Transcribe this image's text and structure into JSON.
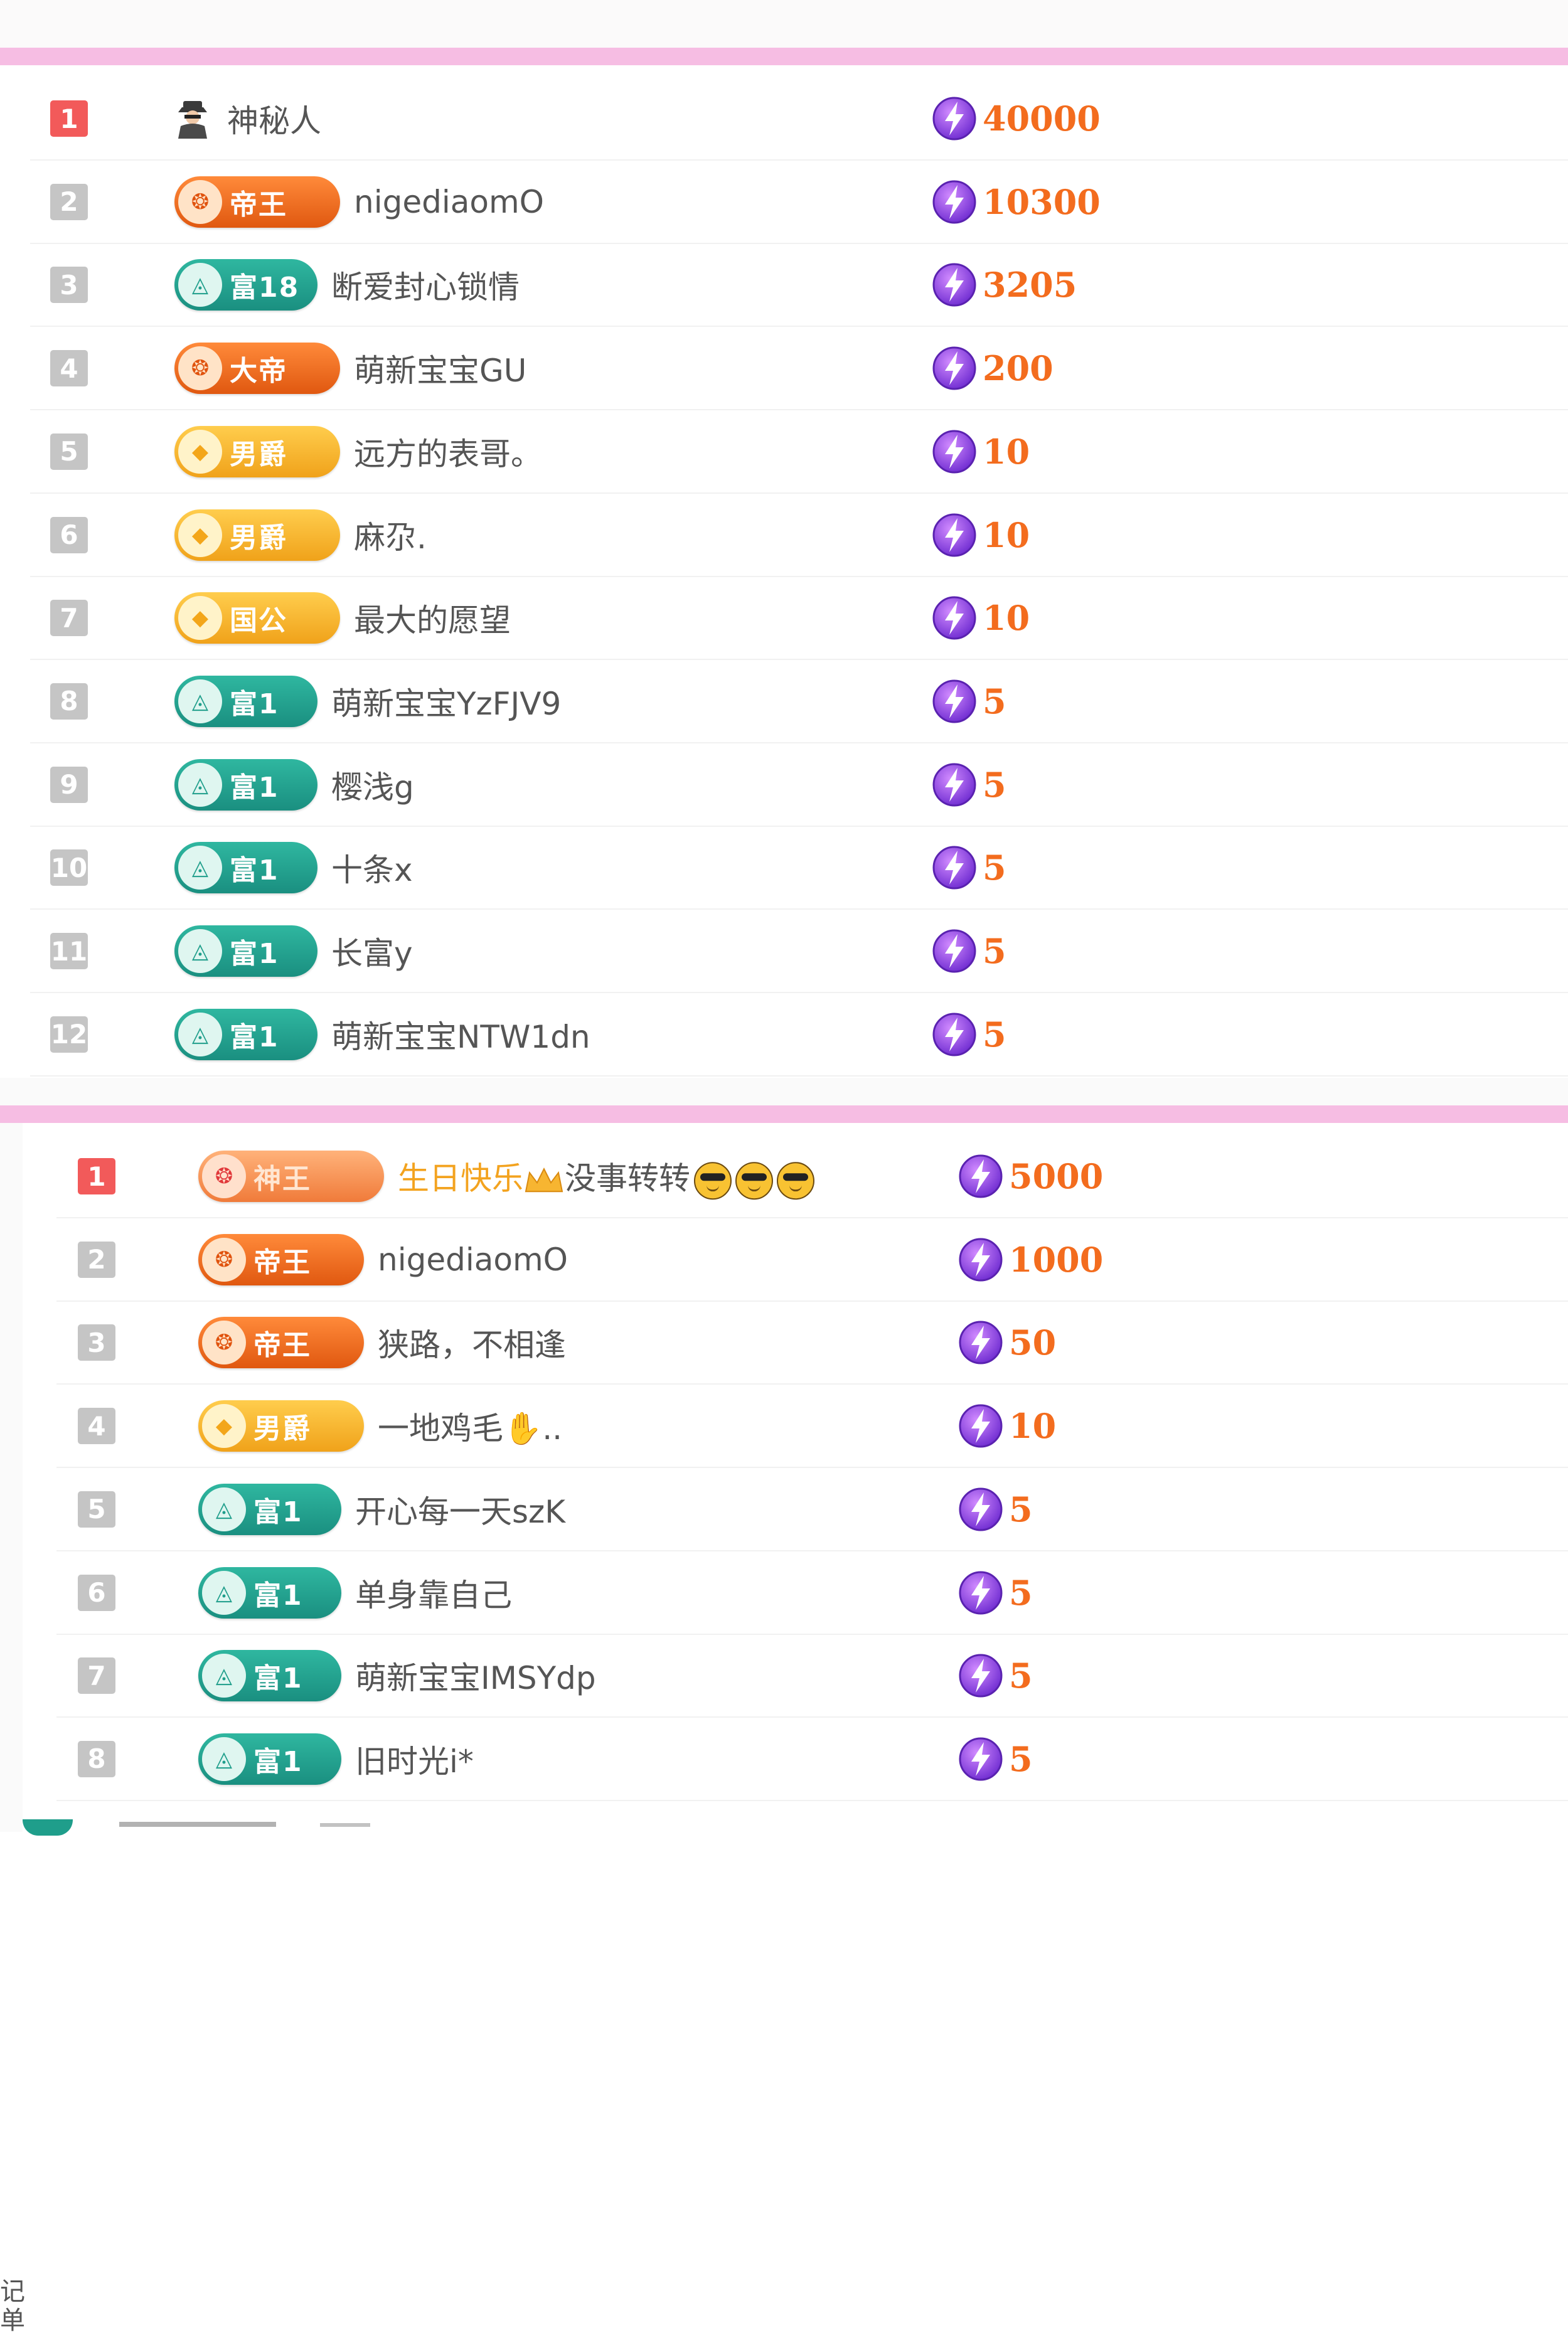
{
  "side_label": "记\n单",
  "section1": {
    "rows": [
      {
        "rank": "1",
        "badge": null,
        "badge_type": "spy",
        "name": "神秘人",
        "amount": "40000"
      },
      {
        "rank": "2",
        "badge": "帝王",
        "badge_type": "orange",
        "name": "nigediaomO",
        "amount": "10300"
      },
      {
        "rank": "3",
        "badge": "富18",
        "badge_type": "teal",
        "name": "断爱封心锁情",
        "amount": "3205"
      },
      {
        "rank": "4",
        "badge": "大帝",
        "badge_type": "orange",
        "name": "萌新宝宝GU",
        "amount": "200"
      },
      {
        "rank": "5",
        "badge": "男爵",
        "badge_type": "gold",
        "name": "远方的表哥。",
        "amount": "10"
      },
      {
        "rank": "6",
        "badge": "男爵",
        "badge_type": "gold",
        "name": "麻尕.",
        "amount": "10"
      },
      {
        "rank": "7",
        "badge": "国公",
        "badge_type": "gold",
        "name": "最大的愿望",
        "amount": "10"
      },
      {
        "rank": "8",
        "badge": "富1",
        "badge_type": "teal",
        "name": "萌新宝宝YzFJV9",
        "amount": "5"
      },
      {
        "rank": "9",
        "badge": "富1",
        "badge_type": "teal",
        "name": "樱浅g",
        "amount": "5"
      },
      {
        "rank": "10",
        "badge": "富1",
        "badge_type": "teal",
        "name": "十条x",
        "amount": "5"
      },
      {
        "rank": "11",
        "badge": "富1",
        "badge_type": "teal",
        "name": "长富y",
        "amount": "5"
      },
      {
        "rank": "12",
        "badge": "富1",
        "badge_type": "teal",
        "name": "萌新宝宝NTW1dn",
        "amount": "5"
      }
    ]
  },
  "section2": {
    "rows": [
      {
        "rank": "1",
        "badge": "神王",
        "badge_type": "god",
        "name": "生日快乐",
        "name_suffix": "没事转转",
        "amount": "5000"
      },
      {
        "rank": "2",
        "badge": "帝王",
        "badge_type": "orange",
        "name": "nigediaomO",
        "amount": "1000"
      },
      {
        "rank": "3",
        "badge": "帝王",
        "badge_type": "orange",
        "name": "狭路，不相逢",
        "amount": "50"
      },
      {
        "rank": "4",
        "badge": "男爵",
        "badge_type": "gold",
        "name": "一地鸡毛",
        "name_suffix": "..",
        "amount": "10"
      },
      {
        "rank": "5",
        "badge": "富1",
        "badge_type": "teal",
        "name": "开心每一天szK",
        "amount": "5"
      },
      {
        "rank": "6",
        "badge": "富1",
        "badge_type": "teal",
        "name": "单身靠自己",
        "amount": "5"
      },
      {
        "rank": "7",
        "badge": "富1",
        "badge_type": "teal",
        "name": "萌新宝宝IMSYdp",
        "amount": "5"
      },
      {
        "rank": "8",
        "badge": "富1",
        "badge_type": "teal",
        "name": "旧时光i*",
        "amount": "5"
      }
    ]
  },
  "colors": {
    "divider": "#f6bde3",
    "amount": "#f36c1e",
    "rank_top": "#f25a5a",
    "rank_other": "#c5c5c5",
    "bolt": "#8b3de0"
  },
  "icons": {
    "currency": "lightning-coin-icon",
    "spy": "mystery-spy-icon",
    "crown": "crown-icon",
    "emoji": "sunglasses-emoji-icon"
  }
}
